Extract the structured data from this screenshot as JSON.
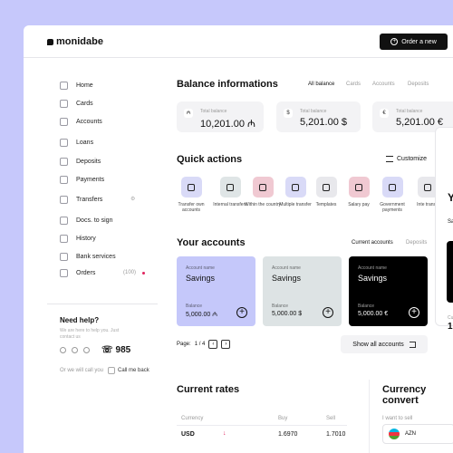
{
  "brand": "monidabe",
  "order_button": "Order a new",
  "sidebar": {
    "items": [
      {
        "label": "Home",
        "icon": "home-icon"
      },
      {
        "label": "Cards",
        "icon": "card-icon"
      },
      {
        "label": "Accounts",
        "icon": "wallet-icon"
      },
      {
        "label": "Loans",
        "icon": "loan-icon"
      },
      {
        "label": "Deposits",
        "icon": "deposit-icon"
      },
      {
        "label": "Payments",
        "icon": "payment-icon"
      },
      {
        "label": "Transfers",
        "icon": "transfer-icon"
      },
      {
        "label": "Docs. to sign",
        "icon": "document-icon"
      },
      {
        "label": "History",
        "icon": "history-icon"
      },
      {
        "label": "Bank services",
        "icon": "bank-icon"
      },
      {
        "label": "Orders",
        "icon": "orders-icon",
        "count": "(100)"
      }
    ],
    "help": {
      "title": "Need help?",
      "subtitle": "We are here to help you. Just contact us",
      "phone": "985",
      "callback_prefix": "Or we will call you",
      "callback_button": "Call me back"
    }
  },
  "balance": {
    "title": "Balance informations",
    "tabs": [
      "All balance",
      "Cards",
      "Accounts",
      "Deposits"
    ],
    "cards": [
      {
        "label": "Total balance",
        "value": "10,201.00 ₼",
        "currency_icon": "₼"
      },
      {
        "label": "Total balance",
        "value": "5,201.00 $",
        "currency_icon": "$"
      },
      {
        "label": "Total balance",
        "value": "5,201.00 €",
        "currency_icon": "€"
      }
    ]
  },
  "quick_actions": {
    "title": "Quick actions",
    "customize": "Customize",
    "items": [
      {
        "label": "Transfer own accounts",
        "color": "#d9daf7"
      },
      {
        "label": "Internal transfers",
        "color": "#dfe5e6"
      },
      {
        "label": "Within the country",
        "color": "#f0c9d2"
      },
      {
        "label": "Multiple transfer",
        "color": "#d9daf7"
      },
      {
        "label": "Templates",
        "color": "#e8e8ec"
      },
      {
        "label": "Salary pay",
        "color": "#f0c9d2"
      },
      {
        "label": "Government payments",
        "color": "#d9daf7"
      },
      {
        "label": "Inte transa",
        "color": "#e8e8ec"
      }
    ]
  },
  "accounts": {
    "title": "Your accounts",
    "tabs": [
      "Current accounts",
      "Deposits"
    ],
    "cards": [
      {
        "name_label": "Account name",
        "name": "Savings",
        "balance_label": "Balance",
        "balance": "5,000.00 ₼",
        "bg": "#c5c8fa",
        "fg": "#111"
      },
      {
        "name_label": "Account name",
        "name": "Savings",
        "balance_label": "Balance",
        "balance": "5,000.00 $",
        "bg": "#dde3e4",
        "fg": "#111"
      },
      {
        "name_label": "Account name",
        "name": "Savings",
        "balance_label": "Balance",
        "balance": "5,000.00 €",
        "bg": "#000000",
        "fg": "#ffffff"
      }
    ],
    "page_label": "Page:",
    "page": "1 / 4",
    "show_all": "Show all accounts"
  },
  "rates": {
    "title": "Current rates",
    "headers": [
      "Currency",
      "Buy",
      "Sell"
    ],
    "rows": [
      {
        "currency": "USD",
        "buy": "1.6970",
        "sell": "1.7010"
      }
    ]
  },
  "converter": {
    "title": "Currency convert",
    "want_label": "I want to sell",
    "currency": "AZN"
  },
  "right_panel": {
    "heading": "Y",
    "sub": "Sa",
    "c": "Cu",
    "b": "1"
  }
}
